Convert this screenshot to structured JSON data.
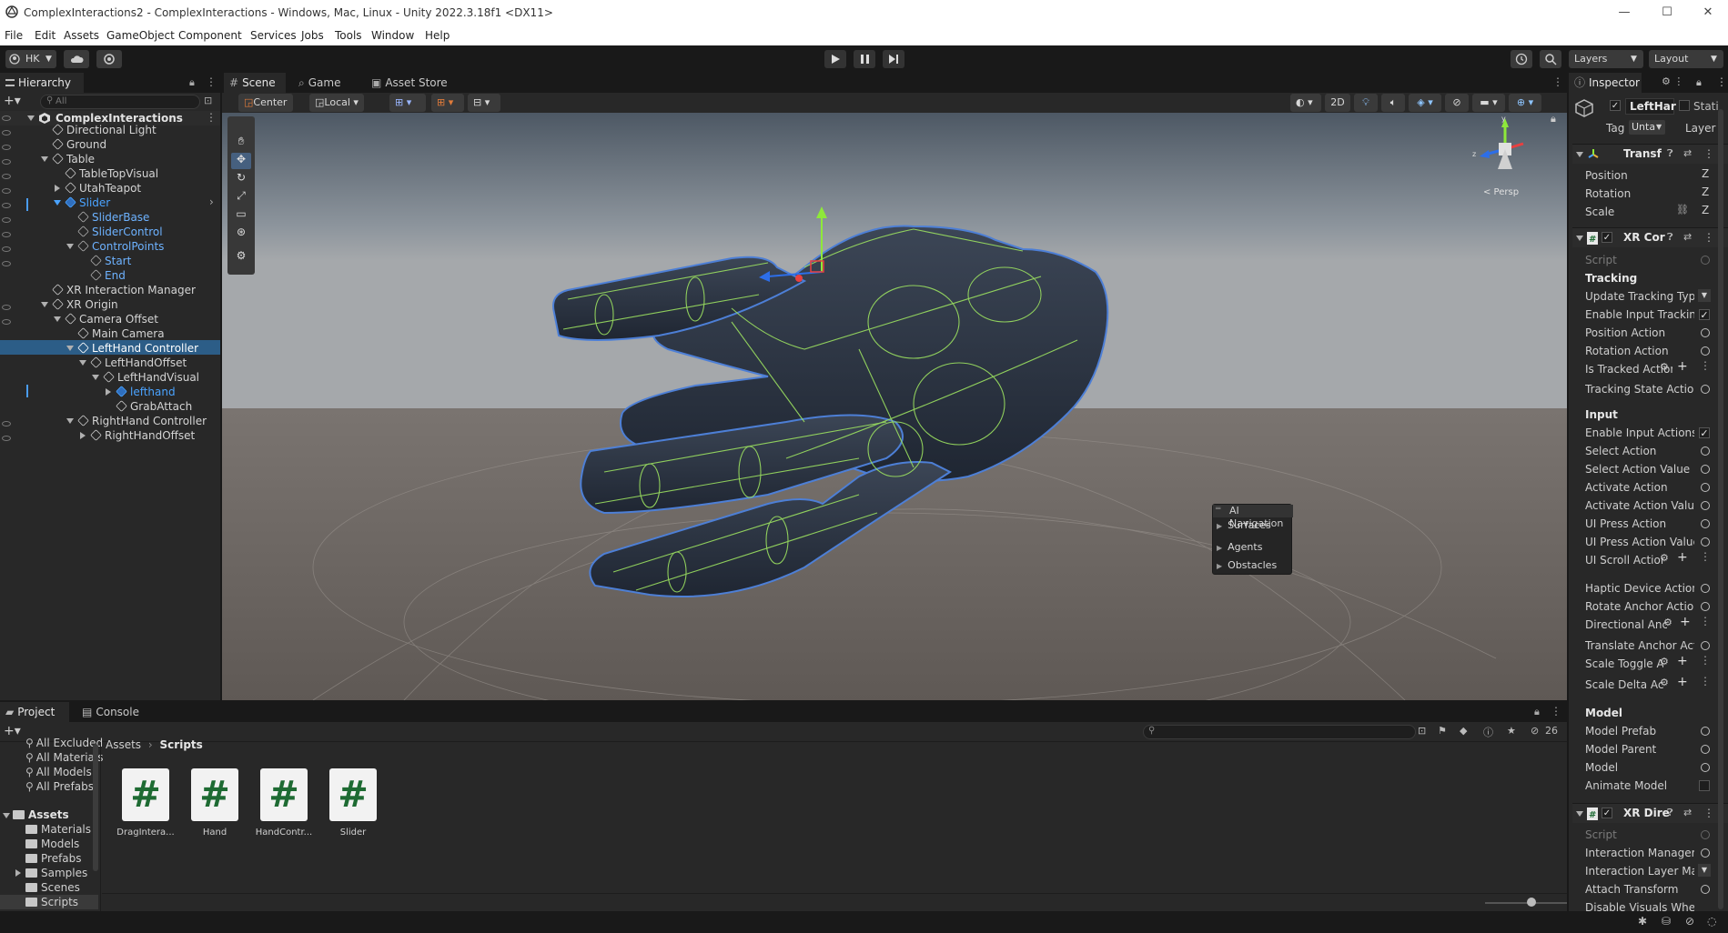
{
  "window": {
    "title": "ComplexInteractions2 - ComplexInteractions - Windows, Mac, Linux - Unity 2022.3.18f1 <DX11>",
    "minimize": "—",
    "maximize": "☐",
    "close": "✕"
  },
  "menu": [
    "File",
    "Edit",
    "Assets",
    "GameObject",
    "Component",
    "Services",
    "Jobs",
    "Tools",
    "Window",
    "Help"
  ],
  "toolbar": {
    "account": "HK",
    "layers": "Layers",
    "layout": "Layout"
  },
  "hierarchy": {
    "tab": "Hierarchy",
    "search_placeholder": "All",
    "scene": "ComplexInteractions",
    "items": [
      {
        "label": "Directional Light"
      },
      {
        "label": "Ground"
      },
      {
        "label": "Table"
      },
      {
        "label": "TableTopVisual"
      },
      {
        "label": "UtahTeapot"
      },
      {
        "label": "Slider"
      },
      {
        "label": "SliderBase"
      },
      {
        "label": "SliderControl"
      },
      {
        "label": "ControlPoints"
      },
      {
        "label": "Start"
      },
      {
        "label": "End"
      },
      {
        "label": "XR Interaction Manager"
      },
      {
        "label": "XR Origin"
      },
      {
        "label": "Camera Offset"
      },
      {
        "label": "Main Camera"
      },
      {
        "label": "LeftHand Controller"
      },
      {
        "label": "LeftHandOffset"
      },
      {
        "label": "LeftHandVisual"
      },
      {
        "label": "lefthand"
      },
      {
        "label": "GrabAttach"
      },
      {
        "label": "RightHand Controller"
      },
      {
        "label": "RightHandOffset"
      }
    ]
  },
  "scene_view": {
    "tabs": [
      "Scene",
      "Game",
      "Asset Store"
    ],
    "pivot": "Center",
    "space": "Local",
    "mode_2d": "2D",
    "gizmo_label": "< Persp",
    "ai_navigation": {
      "title": "AI Navigation",
      "items": [
        "Surfaces",
        "Agents",
        "Obstacles"
      ]
    }
  },
  "inspector": {
    "tab": "Inspector",
    "object_name": "LeftHar",
    "static_label": "Stati",
    "tag_label": "Tag",
    "tag_value": "Unta",
    "layer_label": "Layer",
    "transform": {
      "title": "Transf",
      "position": "Position",
      "rotation": "Rotation",
      "scale": "Scale",
      "axis": "Z"
    },
    "xr_controller": {
      "title": "XR Cor",
      "script": "Script",
      "sections": {
        "tracking": "Tracking",
        "input": "Input",
        "model": "Model"
      },
      "tracking_rows": [
        "Update Tracking Typ",
        "Enable Input Tracking",
        "Position Action",
        "Rotation Action",
        "Is Tracked Action",
        "Tracking State Action"
      ],
      "input_rows": [
        "Enable Input Actions",
        "Select Action",
        "Select Action Value",
        "Activate Action",
        "Activate Action Value",
        "UI Press Action",
        "UI Press Action Value",
        "UI Scroll Action",
        "Haptic Device Action",
        "Rotate Anchor Action",
        "Directional Anchor Rotation",
        "Translate Anchor Action",
        "Scale Toggle Action",
        "Scale Delta Action"
      ],
      "model_rows": [
        "Model Prefab",
        "Model Parent",
        "Model",
        "Animate Model"
      ]
    },
    "xr_direct": {
      "title": "XR Dire",
      "rows": [
        "Script",
        "Interaction Manager",
        "Interaction Layer Mask",
        "Attach Transform",
        "Disable Visuals When"
      ]
    }
  },
  "project": {
    "tabs": [
      "Project",
      "Console"
    ],
    "search_placeholder": "",
    "hidden_count": "26",
    "favorites": [
      "All Excluded",
      "All Materials",
      "All Models",
      "All Prefabs"
    ],
    "assets_root": "Assets",
    "folders": [
      "Materials",
      "Models",
      "Prefabs",
      "Samples",
      "Scenes",
      "Scripts"
    ],
    "breadcrumb": [
      "Assets",
      "Scripts"
    ],
    "files": [
      {
        "name": "DragIntera...",
        "glyph": "#"
      },
      {
        "name": "Hand",
        "glyph": "#"
      },
      {
        "name": "HandContr...",
        "glyph": "#"
      },
      {
        "name": "Slider",
        "glyph": "#"
      }
    ]
  }
}
